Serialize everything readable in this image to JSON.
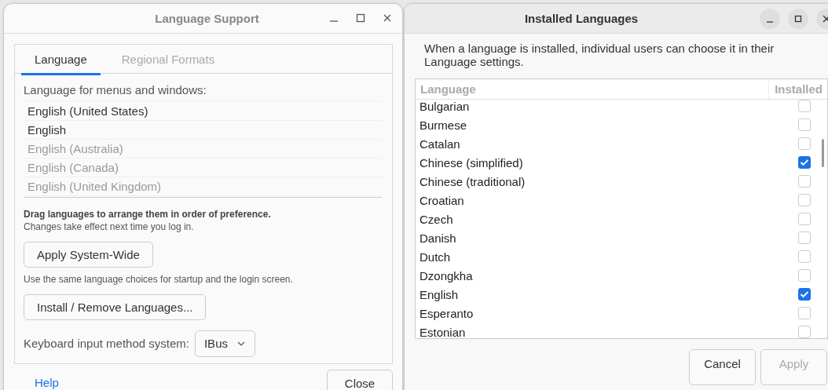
{
  "language_support": {
    "window": {
      "title": "Language Support"
    },
    "tabs": [
      {
        "label": "Language",
        "selected": true
      },
      {
        "label": "Regional Formats",
        "selected": false
      }
    ],
    "list_label": "Language for menus and windows:",
    "languages": [
      {
        "name": "English (United States)",
        "active": true
      },
      {
        "name": "English",
        "active": true
      },
      {
        "name": "English (Australia)",
        "active": false
      },
      {
        "name": "English (Canada)",
        "active": false
      },
      {
        "name": "English (United Kingdom)",
        "active": false
      }
    ],
    "drag_hint": "Drag languages to arrange them in order of preference.",
    "drag_note": "Changes take effect next time you log in.",
    "apply_button": "Apply System-Wide",
    "apply_note": "Use the same language choices for startup and the login screen.",
    "install_button": "Install / Remove Languages...",
    "input_method_label": "Keyboard input method system:",
    "input_method_value": "IBus",
    "help_link": "Help",
    "close_button": "Close"
  },
  "installed_languages": {
    "window": {
      "title": "Installed Languages"
    },
    "description": "When a language is installed, individual users can choose it in their Language settings.",
    "table": {
      "columns": [
        "Language",
        "Installed"
      ],
      "rows": [
        {
          "name": "Bulgarian",
          "checked": false
        },
        {
          "name": "Burmese",
          "checked": false
        },
        {
          "name": "Catalan",
          "checked": false
        },
        {
          "name": "Chinese (simplified)",
          "checked": true
        },
        {
          "name": "Chinese (traditional)",
          "checked": false
        },
        {
          "name": "Croatian",
          "checked": false
        },
        {
          "name": "Czech",
          "checked": false
        },
        {
          "name": "Danish",
          "checked": false
        },
        {
          "name": "Dutch",
          "checked": false
        },
        {
          "name": "Dzongkha",
          "checked": false
        },
        {
          "name": "English",
          "checked": true
        },
        {
          "name": "Esperanto",
          "checked": false
        },
        {
          "name": "Estonian",
          "checked": false
        }
      ]
    },
    "buttons": [
      {
        "label": "Cancel",
        "disabled": false
      },
      {
        "label": "Apply",
        "disabled": true
      }
    ]
  }
}
